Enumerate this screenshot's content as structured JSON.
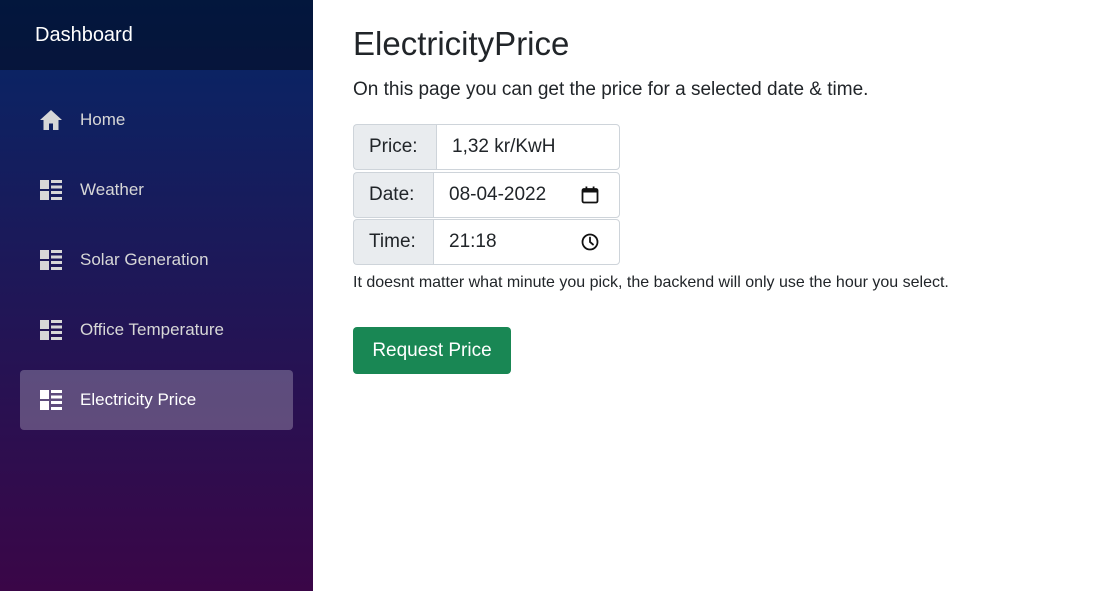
{
  "sidebar": {
    "brand": "Dashboard",
    "items": [
      {
        "label": "Home",
        "icon": "home-icon"
      },
      {
        "label": "Weather",
        "icon": "list-rich-icon"
      },
      {
        "label": "Solar Generation",
        "icon": "list-rich-icon"
      },
      {
        "label": "Office Temperature",
        "icon": "list-rich-icon"
      },
      {
        "label": "Electricity Price",
        "icon": "list-rich-icon",
        "active": true
      }
    ]
  },
  "main": {
    "title": "ElectricityPrice",
    "intro": "On this page you can get the price for a selected date & time.",
    "price": {
      "label": "Price:",
      "value": "1,32 kr/KwH"
    },
    "date": {
      "label": "Date:",
      "value": "08-04-2022",
      "icon": "calendar-icon"
    },
    "time": {
      "label": "Time:",
      "value": "21:18",
      "icon": "clock-icon"
    },
    "hint": "It doesnt matter what minute you pick, the backend will only use the hour you select.",
    "button": "Request Price"
  },
  "colors": {
    "sidebar_top": "#052767",
    "sidebar_bottom": "#3a0647",
    "button": "#198754",
    "addon_bg": "#e9ecef",
    "border": "#ced4da"
  }
}
